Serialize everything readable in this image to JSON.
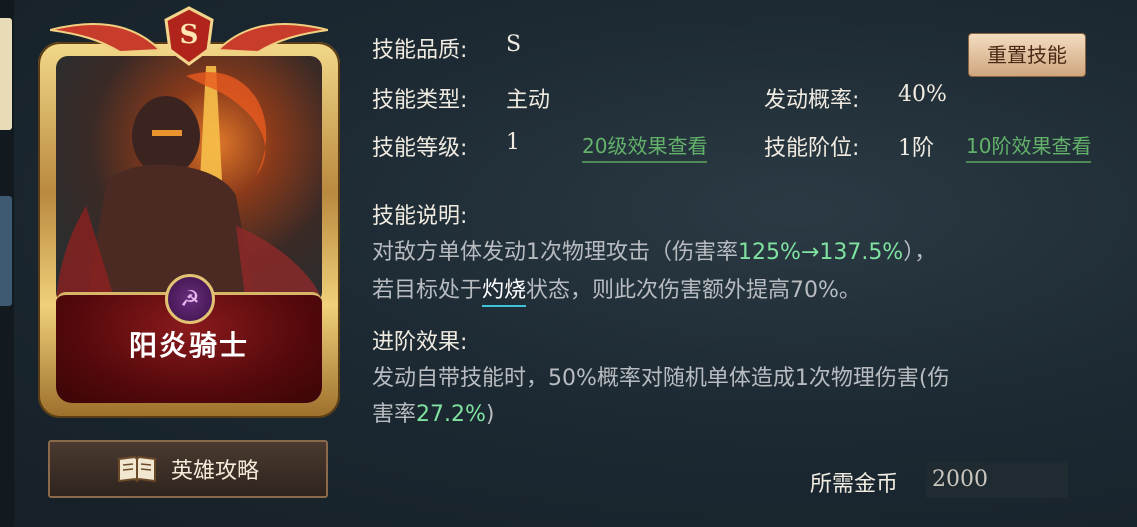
{
  "card": {
    "rank": "S",
    "hero_name": "阳炎骑士",
    "faction_icon": "crossed-faction-icon"
  },
  "guide_button": {
    "label": "英雄攻略",
    "icon": "book-icon"
  },
  "skill": {
    "quality_label": "技能品质:",
    "quality_value": "S",
    "type_label": "技能类型:",
    "type_value": "主动",
    "level_label": "技能等级:",
    "level_value": "1",
    "level_link": "20级效果查看",
    "chance_label": "发动概率:",
    "chance_value": "40%",
    "tier_label": "技能阶位:",
    "tier_value": "1阶",
    "tier_link": "10阶效果查看",
    "reset_button": "重置技能"
  },
  "description": {
    "title": "技能说明:",
    "line1_a": "对敌方单体发动1次物理攻击（伤害率",
    "line1_green": "125%→137.5%",
    "line1_b": "），",
    "line2_a": "若目标处于",
    "line2_keyword": "灼烧",
    "line2_b": "状态，则此次伤害额外提高70%。"
  },
  "advance": {
    "title": "进阶效果:",
    "line1": "发动自带技能时，50%概率对随机单体造成1次物理伤害(伤",
    "line2_a": "害率",
    "line2_green": "27.2%",
    "line2_b": ")"
  },
  "cost": {
    "label": "所需金币",
    "value": "2000"
  },
  "colors": {
    "link_green": "#63b16a",
    "highlight_green": "#7fe2a0",
    "keyword_underline": "#3ec3d8"
  }
}
